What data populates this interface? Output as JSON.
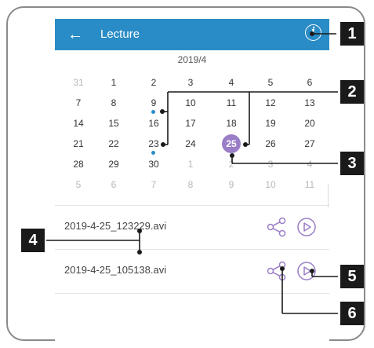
{
  "appbar": {
    "title": "Lecture",
    "back_icon": "←",
    "info_icon": "i",
    "color": "#2a8cc6"
  },
  "calendar": {
    "month_label": "2019/4",
    "selected_day": "25",
    "selected_color": "#9a7ec7",
    "rows": [
      [
        {
          "d": "31",
          "o": true
        },
        {
          "d": "1"
        },
        {
          "d": "2"
        },
        {
          "d": "3"
        },
        {
          "d": "4"
        },
        {
          "d": "5"
        },
        {
          "d": "6"
        }
      ],
      [
        {
          "d": "7"
        },
        {
          "d": "8"
        },
        {
          "d": "9",
          "dot": true
        },
        {
          "d": "10"
        },
        {
          "d": "11"
        },
        {
          "d": "12"
        },
        {
          "d": "13"
        }
      ],
      [
        {
          "d": "14"
        },
        {
          "d": "15"
        },
        {
          "d": "16"
        },
        {
          "d": "17"
        },
        {
          "d": "18"
        },
        {
          "d": "19"
        },
        {
          "d": "20"
        }
      ],
      [
        {
          "d": "21"
        },
        {
          "d": "22"
        },
        {
          "d": "23",
          "dot": true
        },
        {
          "d": "24"
        },
        {
          "d": "25",
          "sel": true
        },
        {
          "d": "26"
        },
        {
          "d": "27"
        }
      ],
      [
        {
          "d": "28"
        },
        {
          "d": "29"
        },
        {
          "d": "30"
        },
        {
          "d": "1",
          "o": true
        },
        {
          "d": "2",
          "o": true
        },
        {
          "d": "3",
          "o": true
        },
        {
          "d": "4",
          "o": true
        }
      ],
      [
        {
          "d": "5",
          "o": true
        },
        {
          "d": "6",
          "o": true
        },
        {
          "d": "7",
          "o": true
        },
        {
          "d": "8",
          "o": true
        },
        {
          "d": "9",
          "o": true
        },
        {
          "d": "10",
          "o": true
        },
        {
          "d": "11",
          "o": true
        }
      ]
    ]
  },
  "files": [
    {
      "name": "2019-4-25_123229.avi",
      "share_icon": "share-icon",
      "play_icon": "play-icon"
    },
    {
      "name": "2019-4-25_105138.avi",
      "share_icon": "share-icon",
      "play_icon": "play-icon"
    }
  ],
  "callouts": [
    "1",
    "2",
    "3",
    "4",
    "5",
    "6"
  ]
}
